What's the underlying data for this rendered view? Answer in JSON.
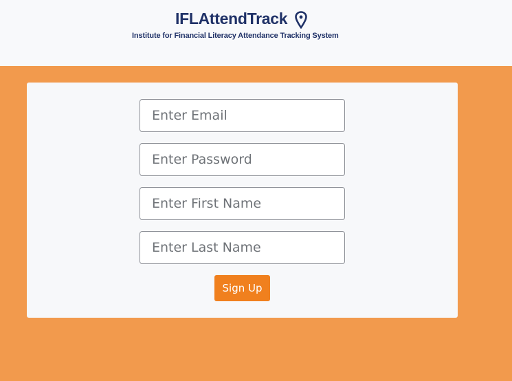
{
  "header": {
    "logo_title": "IFLAttendTrack",
    "logo_subtitle": "Institute for Financial Literacy Attendance Tracking System",
    "logo_icon": "map-pin-icon"
  },
  "form": {
    "email": {
      "placeholder": "Enter Email",
      "value": ""
    },
    "password": {
      "placeholder": "Enter Password",
      "value": ""
    },
    "first_name": {
      "placeholder": "Enter First Name",
      "value": ""
    },
    "last_name": {
      "placeholder": "Enter Last Name",
      "value": ""
    },
    "submit_label": "Sign Up"
  },
  "colors": {
    "page_background": "#f29a4d",
    "header_background": "#f8f9fb",
    "card_background": "#f7f8fa",
    "brand_navy": "#1f3167",
    "button_background": "#f0801e",
    "button_text": "#ffffff"
  }
}
